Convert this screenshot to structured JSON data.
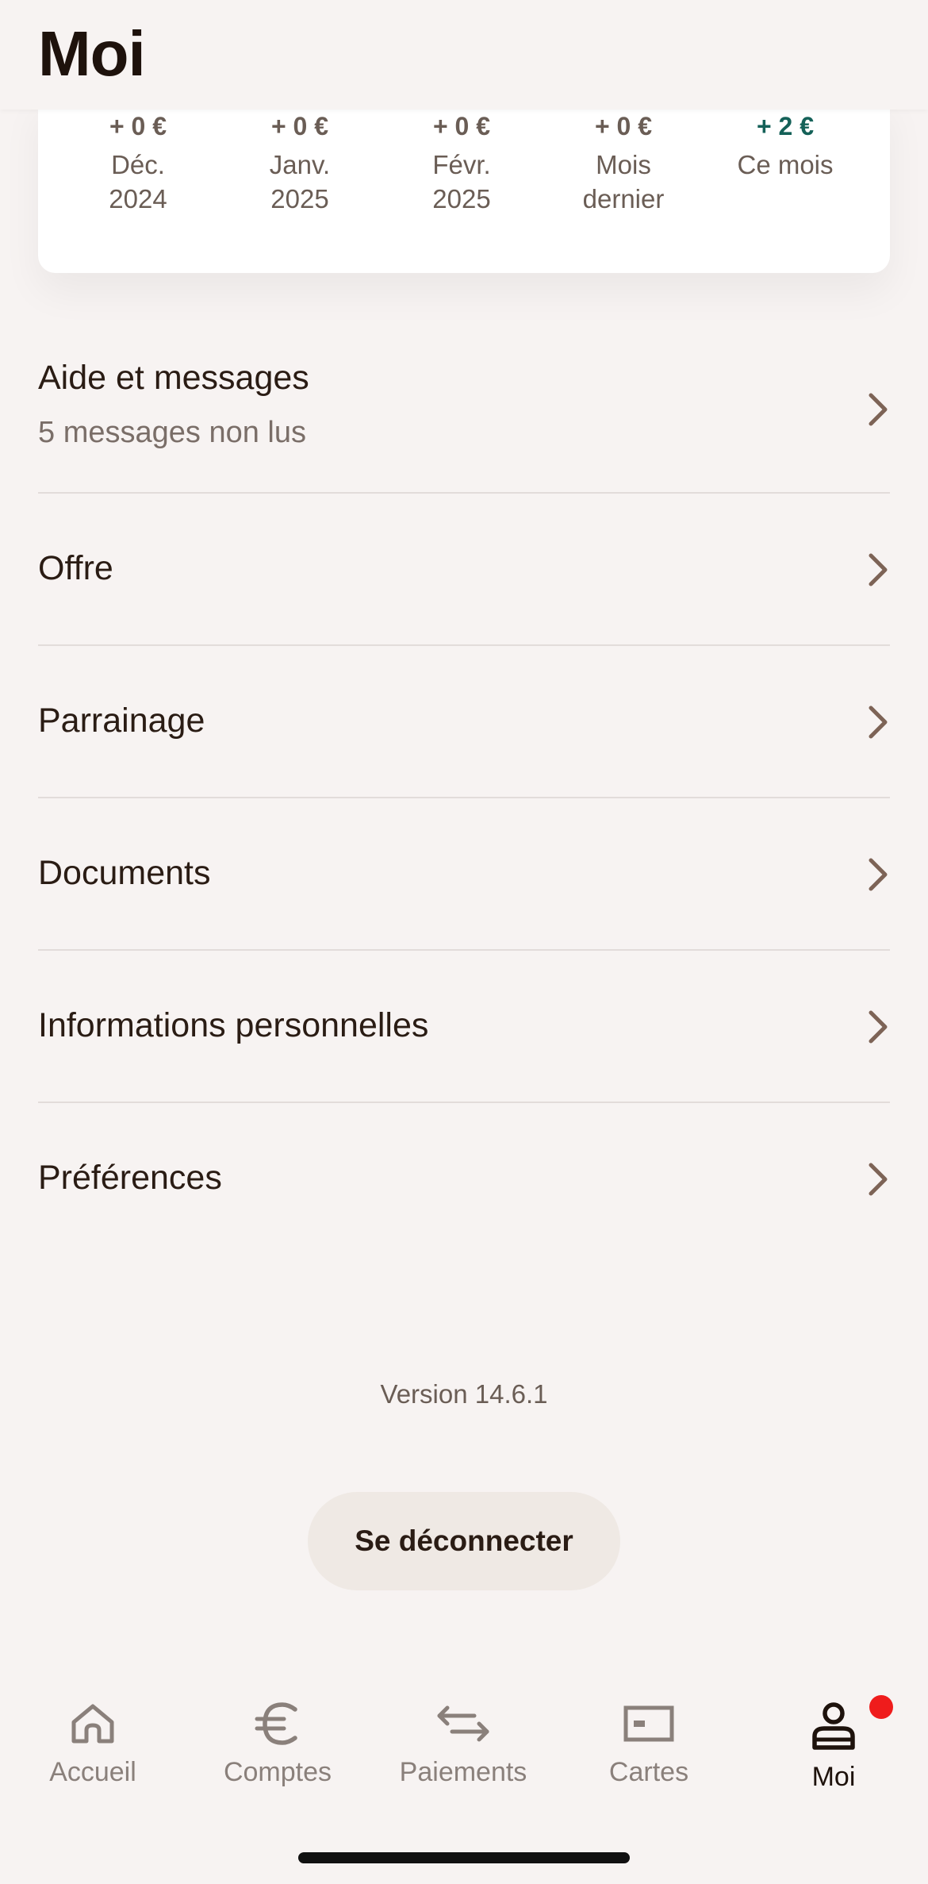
{
  "header": {
    "title": "Moi"
  },
  "summary": {
    "months": [
      {
        "amount": "+ 0 €",
        "label": "Déc.\n2024",
        "positive": false
      },
      {
        "amount": "+ 0 €",
        "label": "Janv.\n2025",
        "positive": false
      },
      {
        "amount": "+ 0 €",
        "label": "Févr.\n2025",
        "positive": false
      },
      {
        "amount": "+ 0 €",
        "label": "Mois\ndernier",
        "positive": false
      },
      {
        "amount": "+ 2 €",
        "label": "Ce mois",
        "positive": true
      }
    ],
    "positive_color": "#146158"
  },
  "menu": {
    "items": [
      {
        "title": "Aide et messages",
        "subtitle": "5 messages non lus"
      },
      {
        "title": "Offre"
      },
      {
        "title": "Parrainage"
      },
      {
        "title": "Documents"
      },
      {
        "title": "Informations personnelles"
      },
      {
        "title": "Préférences"
      }
    ],
    "chevron_icon": "chevron-right-icon"
  },
  "footer": {
    "version": "Version 14.6.1",
    "logout_label": "Se déconnecter"
  },
  "tabbar": {
    "tabs": [
      {
        "label": "Accueil",
        "icon": "home-icon",
        "active": false
      },
      {
        "label": "Comptes",
        "icon": "euro-icon",
        "active": false
      },
      {
        "label": "Paiements",
        "icon": "transfer-arrows-icon",
        "active": false
      },
      {
        "label": "Cartes",
        "icon": "card-icon",
        "active": false
      },
      {
        "label": "Moi",
        "icon": "user-icon",
        "active": true
      }
    ],
    "notification_color": "#ef1c1c"
  }
}
